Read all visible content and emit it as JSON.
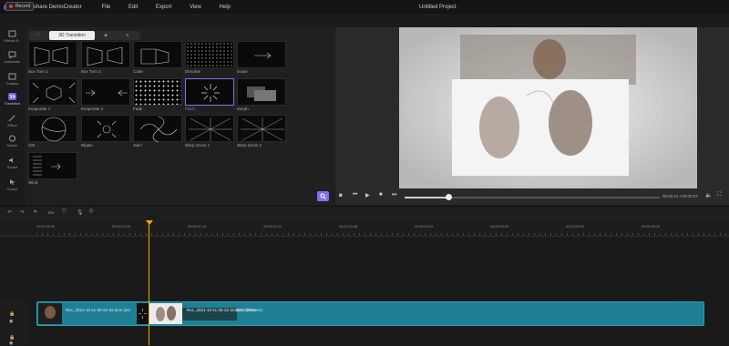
{
  "app": {
    "title": "Wondershare DemoCreator",
    "project": "Untitled Project"
  },
  "menu": [
    "File",
    "Edit",
    "Export",
    "View",
    "Help"
  ],
  "record_label": "Record",
  "rail": [
    {
      "label": "Effects S..",
      "icon": "effects-icon"
    },
    {
      "label": "Annotatio",
      "icon": "annotation-icon"
    },
    {
      "label": "Caption",
      "icon": "caption-icon"
    },
    {
      "label": "Transition",
      "icon": "transition-icon",
      "active": true
    },
    {
      "label": "Effect",
      "icon": "effect-icon"
    },
    {
      "label": "Sticker",
      "icon": "sticker-icon"
    },
    {
      "label": "Sound",
      "icon": "sound-icon"
    },
    {
      "label": "Cursor",
      "icon": "cursor-icon"
    }
  ],
  "library_tabs": [
    {
      "label": "",
      "icon": "heart-icon"
    },
    {
      "label": "3D Transition",
      "selected": true
    },
    {
      "label": "",
      "icon": "cube-icon"
    },
    {
      "label": "",
      "icon": "list-icon"
    }
  ],
  "transitions": [
    {
      "label": "Box Turn 1"
    },
    {
      "label": "Box Turn 2"
    },
    {
      "label": "Cube"
    },
    {
      "label": "Dissolve"
    },
    {
      "label": "Erase"
    },
    {
      "label": "Evaporate 1"
    },
    {
      "label": "Evaporate 2"
    },
    {
      "label": "Fade"
    },
    {
      "label": "Flash",
      "selected": true
    },
    {
      "label": "Morph"
    },
    {
      "label": "Orb"
    },
    {
      "label": "Ripple"
    },
    {
      "label": "Swirl"
    },
    {
      "label": "Warp Zoom 1"
    },
    {
      "label": "Warp Zoom 2"
    },
    {
      "label": "Wind"
    }
  ],
  "player": {
    "time": "00:00:01 / 00:00:07"
  },
  "ruler": [
    "00:00:00:00",
    "00:00:00:20",
    "00:00:01:16",
    "00:00:02:12",
    "00:00:03:08",
    "00:00:04:04",
    "00:00:05:00",
    "00:00:05:20",
    "00:00:06:16"
  ],
  "clips": {
    "clip1_label": "Rec_2021-10-11 05-22-32.dcm (Scr",
    "clip2_label": "Rec_2021-10-11 05-22-32.dcm (Webc",
    "clip2_suffix": "Webc (Screen)"
  },
  "colors": {
    "accent": "#8a6cf2",
    "clip": "#1f7f94",
    "playhead": "#f2a900"
  }
}
